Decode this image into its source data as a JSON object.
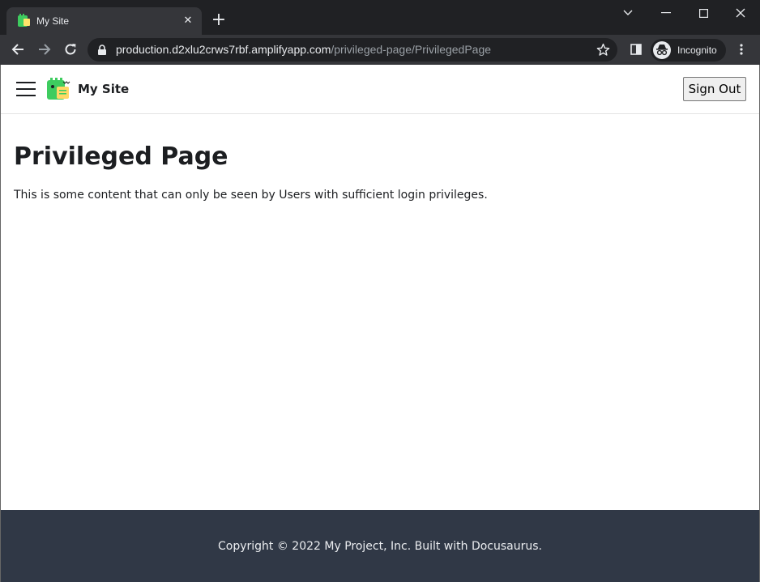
{
  "browser": {
    "tab_title": "My Site",
    "url_host": "production.d2xlu2crws7rbf.amplifyapp.com",
    "url_path": "/privileged-page/PrivilegedPage",
    "profile_label": "Incognito",
    "colors": {
      "tabstrip": "#202124",
      "toolbar": "#35363a",
      "text": "#e8eaed"
    }
  },
  "navbar": {
    "site_title": "My Site",
    "signout_label": "Sign Out"
  },
  "main": {
    "heading": "Privileged Page",
    "body": "This is some content that can only be seen by Users with sufficient login privileges."
  },
  "footer": {
    "text": "Copyright © 2022 My Project, Inc. Built with Docusaurus.",
    "background": "#303846"
  }
}
